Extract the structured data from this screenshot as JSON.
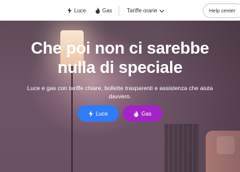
{
  "header": {
    "nav": [
      {
        "label": "Luce",
        "icon": "lightning-icon"
      },
      {
        "label": "Gas",
        "icon": "flame-icon"
      }
    ],
    "tariffe_label": "Tariffe orarie",
    "help_label": "Help center"
  },
  "hero": {
    "headline_line1": "Che poi non ci sarebbe",
    "headline_line2": "nulla di speciale",
    "subtext_line1": "Luce e gas con tariffe chiare, bollette trasparenti e assistenza che aiuta",
    "subtext_line2": "davvero.",
    "cta_luce_label": "Luce",
    "cta_gas_label": "Gas"
  },
  "colors": {
    "luce_button": "#2f7cf6",
    "gas_button": "#a423c6",
    "text_dark": "#3a3140"
  }
}
